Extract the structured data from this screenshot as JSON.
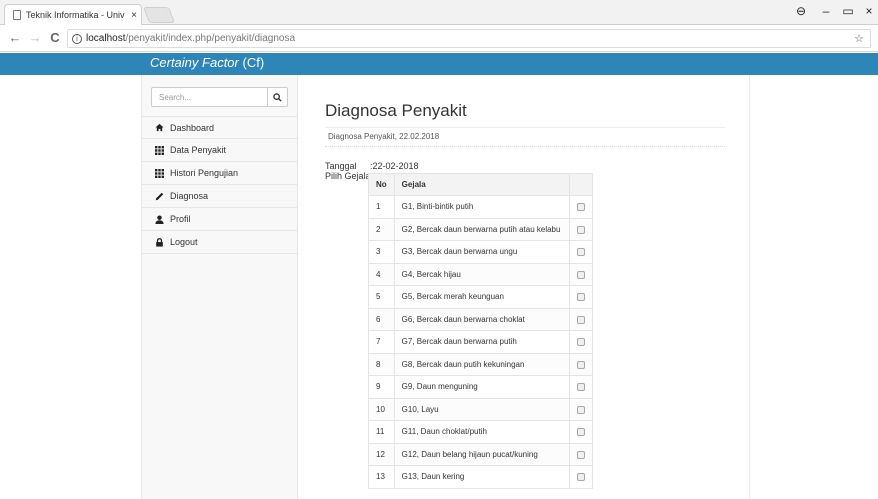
{
  "browser": {
    "tab_title": "Teknik Informatika - Univ",
    "tab_close": "×",
    "url_host": "localhost",
    "url_path": "/penyakit/index.php/penyakit/diagnosa",
    "window_controls": {
      "account": "⊖",
      "minimize": "–",
      "restore": "▭",
      "close": "×"
    },
    "nav": {
      "back": "←",
      "forward": "→",
      "reload": "C"
    },
    "star": "☆"
  },
  "header": {
    "brand_main": "Certainy Factor",
    "brand_sub": "(Cf)",
    "color": "#2e86b8"
  },
  "sidebar": {
    "search_placeholder": "Search...",
    "items": [
      {
        "label": "Dashboard",
        "icon": "home-icon"
      },
      {
        "label": "Data Penyakit",
        "icon": "grid-icon"
      },
      {
        "label": "Histori Pengujian",
        "icon": "grid-icon"
      },
      {
        "label": "Diagnosa",
        "icon": "pencil-icon"
      },
      {
        "label": "Profil",
        "icon": "user-icon"
      },
      {
        "label": "Logout",
        "icon": "lock-icon"
      }
    ]
  },
  "main": {
    "title": "Diagnosa Penyakit",
    "subtitle": "Diagnosa Penyakit, 22.02.2018",
    "tanggal_label": "Tanggal",
    "tanggal_value": ":22-02-2018",
    "pilih_label": "Pilih Gejala:",
    "table": {
      "headers": [
        "No",
        "Gejala",
        ""
      ],
      "rows": [
        {
          "no": "1",
          "gejala": "G1, Binti-bintik putih",
          "checked": false
        },
        {
          "no": "2",
          "gejala": "G2, Bercak daun berwarna putih atau kelabu",
          "checked": false
        },
        {
          "no": "3",
          "gejala": "G3, Bercak daun berwarna ungu",
          "checked": false
        },
        {
          "no": "4",
          "gejala": "G4, Bercak hijau",
          "checked": false
        },
        {
          "no": "5",
          "gejala": "G5, Bercak merah keunguan",
          "checked": false
        },
        {
          "no": "6",
          "gejala": "G6, Bercak daun berwarna choklat",
          "checked": false
        },
        {
          "no": "7",
          "gejala": "G7, Bercak daun berwarna putih",
          "checked": false
        },
        {
          "no": "8",
          "gejala": "G8, Bercak daun putih kekuningan",
          "checked": false
        },
        {
          "no": "9",
          "gejala": "G9, Daun menguning",
          "checked": false
        },
        {
          "no": "10",
          "gejala": "G10, Layu",
          "checked": false
        },
        {
          "no": "11",
          "gejala": "G11, Daun choklat/putih",
          "checked": false
        },
        {
          "no": "12",
          "gejala": "G12, Daun belang hijaun pucat/kuning",
          "checked": false
        },
        {
          "no": "13",
          "gejala": "G13, Daun kering",
          "checked": false
        }
      ]
    }
  }
}
